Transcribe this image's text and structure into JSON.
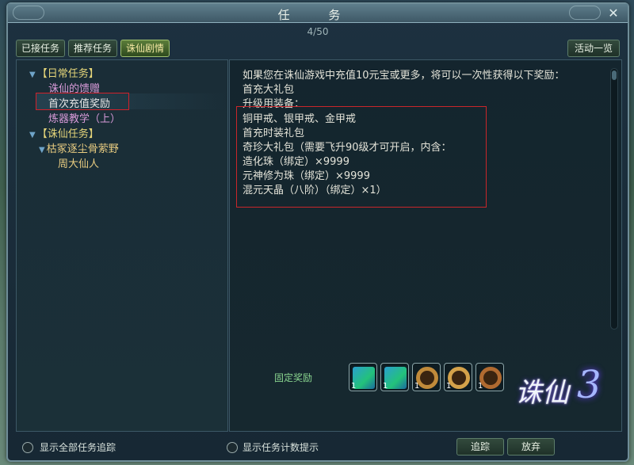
{
  "window": {
    "title": "任 务",
    "page_count": "4/50",
    "close_glyph": "✕"
  },
  "tabs": [
    {
      "label": "已接任务",
      "active": false
    },
    {
      "label": "推荐任务",
      "active": false
    },
    {
      "label": "诛仙剧情",
      "active": true
    }
  ],
  "activity_button": "活动一览",
  "tree": {
    "daily_category": "【日常任务】",
    "daily_items": [
      "诛仙的馈赠",
      "首次充值奖励",
      "炼器教学（上）"
    ],
    "main_category": "【诛仙任务】",
    "sub_category": "枯冢逐尘骨萦野",
    "sub_items": [
      "周大仙人"
    ]
  },
  "description": {
    "lines": [
      "如果您在诛仙游戏中充值10元宝或更多，将可以一次性获得以下奖励：",
      "首充大礼包",
      "升级用装备：",
      "铜甲戒、银甲戒、金甲戒",
      "首充时装礼包",
      "奇珍大礼包（需要飞升90级才可开启，内含：",
      "造化珠（绑定）×9999",
      "元神修为珠（绑定）×9999",
      "混元天晶（八阶）（绑定）×1）"
    ]
  },
  "rewards": {
    "label": "固定奖励",
    "items": [
      {
        "icon": "gift-box-icon",
        "count": "1"
      },
      {
        "icon": "gift-box-icon",
        "count": "1"
      },
      {
        "icon": "ring-icon",
        "count": "1"
      },
      {
        "icon": "ring-icon",
        "count": "1"
      },
      {
        "icon": "ring-icon",
        "count": "1"
      }
    ]
  },
  "logo": {
    "text": "诛仙",
    "number": "3"
  },
  "bottom": {
    "track_all_label": "显示全部任务追踪",
    "count_hint_label": "显示任务计数提示",
    "track_button": "追踪",
    "abandon_button": "放弃"
  },
  "colors": {
    "highlight_box": "#d0212a",
    "category": "#e6d67a",
    "active_tab_text": "#f6e9a4"
  }
}
